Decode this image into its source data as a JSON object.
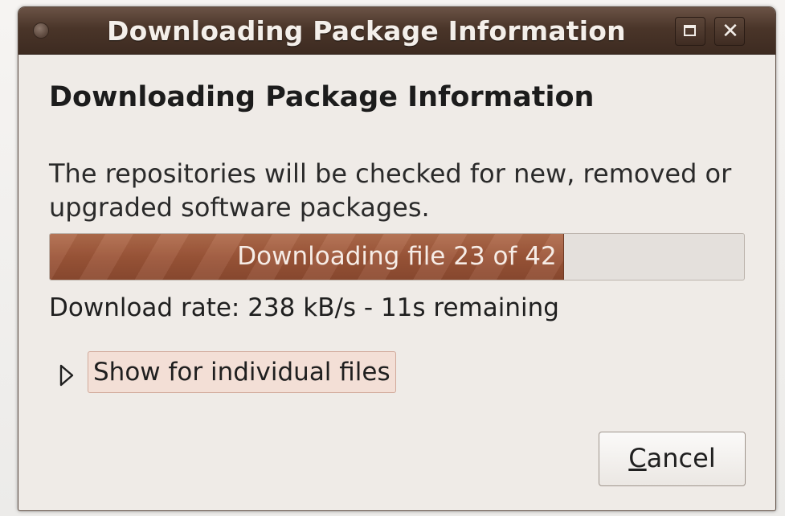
{
  "window": {
    "title": "Downloading Package Information",
    "maximize_icon": "maximize-icon",
    "close_icon": "close-icon",
    "close_glyph": "✕"
  },
  "dialog": {
    "heading": "Downloading Package Information",
    "description": "The repositories will be checked for new, removed or upgraded software packages.",
    "progress": {
      "label": "Downloading file 23 of 42",
      "fraction": 0.74
    },
    "rate_text": "Download rate: 238 kB/s - 11s remaining",
    "expander": {
      "label": "Show for individual files",
      "expanded": false,
      "icon": "triangle-right-icon"
    },
    "cancel": {
      "mnemonic": "C",
      "rest": "ancel"
    }
  },
  "colors": {
    "titlebar": "#4a3529",
    "progress_fill": "#9c5538",
    "background": "#efebe7"
  }
}
